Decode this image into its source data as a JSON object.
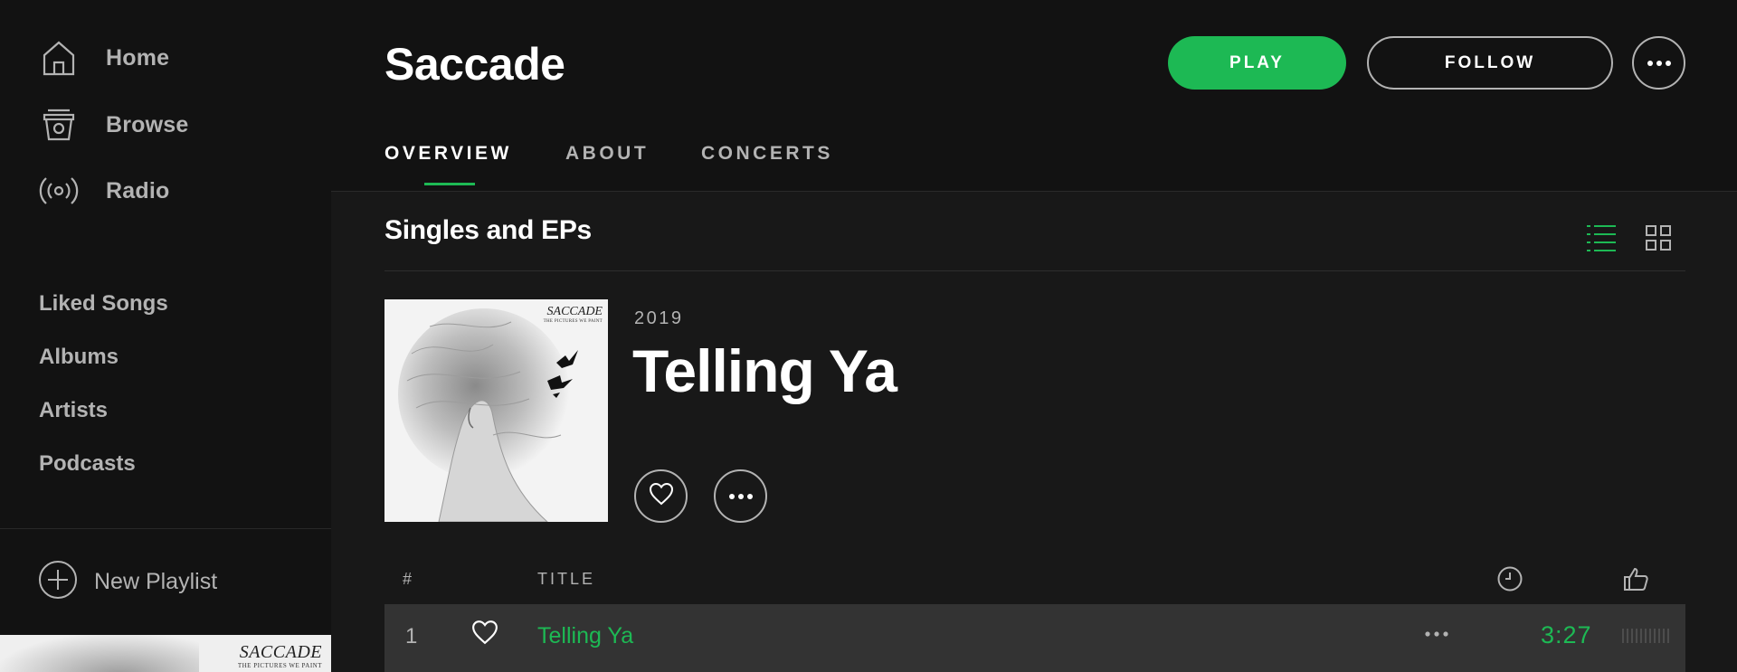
{
  "sidebar": {
    "nav": [
      {
        "label": "Home",
        "icon": "home-icon"
      },
      {
        "label": "Browse",
        "icon": "browse-icon"
      },
      {
        "label": "Radio",
        "icon": "radio-icon"
      }
    ],
    "library": [
      "Liked Songs",
      "Albums",
      "Artists",
      "Podcasts"
    ],
    "new_playlist_label": "New Playlist",
    "cover_thumb": {
      "title": "SACCADE",
      "subtitle": "THE PICTURES WE PAINT"
    }
  },
  "header": {
    "artist_name": "Saccade",
    "play_label": "PLAY",
    "follow_label": "FOLLOW",
    "tabs": [
      {
        "label": "OVERVIEW",
        "active": true
      },
      {
        "label": "ABOUT",
        "active": false
      },
      {
        "label": "CONCERTS",
        "active": false
      }
    ]
  },
  "content": {
    "section_title": "Singles and EPs",
    "view_mode": "list",
    "album": {
      "year": "2019",
      "title": "Telling Ya",
      "cover_title": "SACCADE",
      "cover_subtitle": "THE PICTURES WE PAINT"
    },
    "track_columns": {
      "number": "#",
      "title": "TITLE"
    },
    "tracks": [
      {
        "number": "1",
        "title": "Telling Ya",
        "duration": "3:27",
        "playing": true
      }
    ]
  },
  "colors": {
    "accent": "#1db954",
    "background": "#181818",
    "sidebar": "#121212",
    "row_highlight": "#333333",
    "text_muted": "#b3b3b3"
  }
}
